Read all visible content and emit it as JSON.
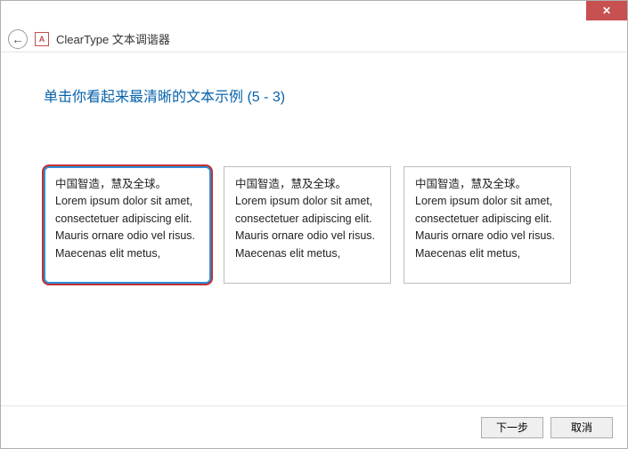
{
  "titlebar": {
    "close_glyph": "✕"
  },
  "header": {
    "back_glyph": "←",
    "icon_glyph": "A",
    "title": "ClearType 文本调谐器"
  },
  "main": {
    "heading": "单击你看起来最清晰的文本示例 (5 - 3)",
    "samples": [
      {
        "selected": true,
        "line_cn": "中国智造，慧及全球。",
        "body": "Lorem ipsum dolor sit amet, consectetuer adipiscing elit. Mauris ornare odio vel risus. Maecenas elit metus,"
      },
      {
        "selected": false,
        "line_cn": "中国智造，慧及全球。",
        "body": "Lorem ipsum dolor sit amet, consectetuer adipiscing elit. Mauris ornare odio vel risus. Maecenas elit metus,"
      },
      {
        "selected": false,
        "line_cn": "中国智造，慧及全球。",
        "body": "Lorem ipsum dolor sit amet, consectetuer adipiscing elit. Mauris ornare odio vel risus. Maecenas elit metus,"
      }
    ]
  },
  "footer": {
    "next_label": "下一步",
    "cancel_label": "取消"
  }
}
